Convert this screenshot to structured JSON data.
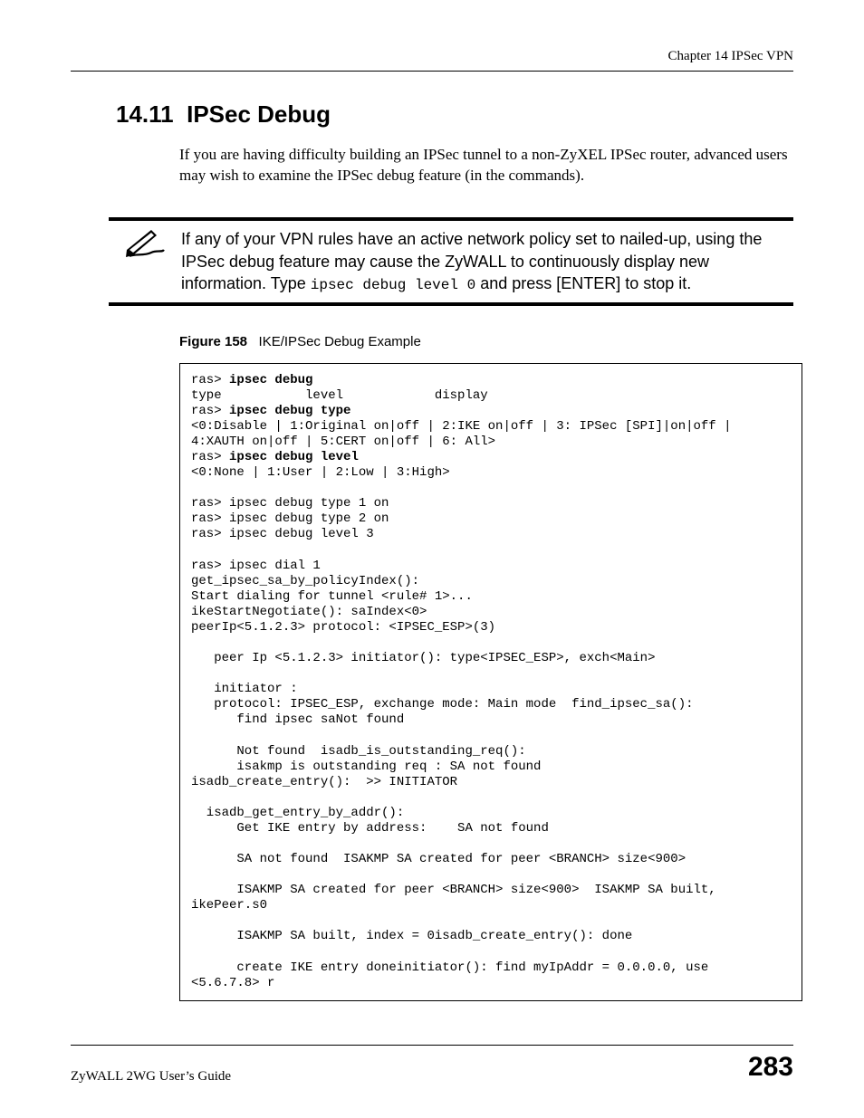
{
  "chapter_header": "Chapter 14 IPSec VPN",
  "section": {
    "number": "14.11",
    "title": "IPSec Debug"
  },
  "body_paragraph": "If you are having difficulty building an IPSec tunnel to a non-ZyXEL IPSec router, advanced users may wish to examine the IPSec debug feature (in the commands).",
  "note": {
    "prefix": "If any of your VPN rules have an active network policy set to nailed-up, using the IPSec debug feature may cause the ZyWALL to continuously display new information. Type ",
    "code": "ipsec debug level 0",
    "suffix": " and press [ENTER] to stop it."
  },
  "figure": {
    "label": "Figure 158",
    "title": "IKE/IPSec Debug Example"
  },
  "code": {
    "l01a": "ras> ",
    "l01b": "ipsec debug",
    "l02": "type           level            display",
    "l03a": "ras> ",
    "l03b": "ipsec debug type",
    "l04": "<0:Disable | 1:Original on|off | 2:IKE on|off | 3: IPSec [SPI]|on|off | ",
    "l05": "4:XAUTH on|off | 5:CERT on|off | 6: All>",
    "l06a": "ras> ",
    "l06b": "ipsec debug level",
    "l07": "<0:None | 1:User | 2:Low | 3:High>",
    "l08": "",
    "l09": "ras> ipsec debug type 1 on",
    "l10": "ras> ipsec debug type 2 on",
    "l11": "ras> ipsec debug level 3",
    "l12": "",
    "l13": "ras> ipsec dial 1",
    "l14": "get_ipsec_sa_by_policyIndex():",
    "l15": "Start dialing for tunnel <rule# 1>...",
    "l16": "ikeStartNegotiate(): saIndex<0>",
    "l17": "peerIp<5.1.2.3> protocol: <IPSEC_ESP>(3)",
    "l18": "",
    "l19": "   peer Ip <5.1.2.3> initiator(): type<IPSEC_ESP>, exch<Main>",
    "l20": "",
    "l21": "   initiator :",
    "l22": "   protocol: IPSEC_ESP, exchange mode: Main mode  find_ipsec_sa():",
    "l23": "      find ipsec saNot found",
    "l24": "",
    "l25": "      Not found  isadb_is_outstanding_req():",
    "l26": "      isakmp is outstanding req : SA not found",
    "l27": "isadb_create_entry():  >> INITIATOR",
    "l28": "",
    "l29": "  isadb_get_entry_by_addr():",
    "l30": "      Get IKE entry by address:    SA not found",
    "l31": "",
    "l32": "      SA not found  ISAKMP SA created for peer <BRANCH> size<900>",
    "l33": "",
    "l34": "      ISAKMP SA created for peer <BRANCH> size<900>  ISAKMP SA built, ",
    "l35": "ikePeer.s0",
    "l36": "",
    "l37": "      ISAKMP SA built, index = 0isadb_create_entry(): done",
    "l38": "",
    "l39": "      create IKE entry doneinitiator(): find myIpAddr = 0.0.0.0, use ",
    "l40": "<5.6.7.8> r"
  },
  "footer": {
    "guide": "ZyWALL 2WG User’s Guide",
    "page": "283"
  }
}
